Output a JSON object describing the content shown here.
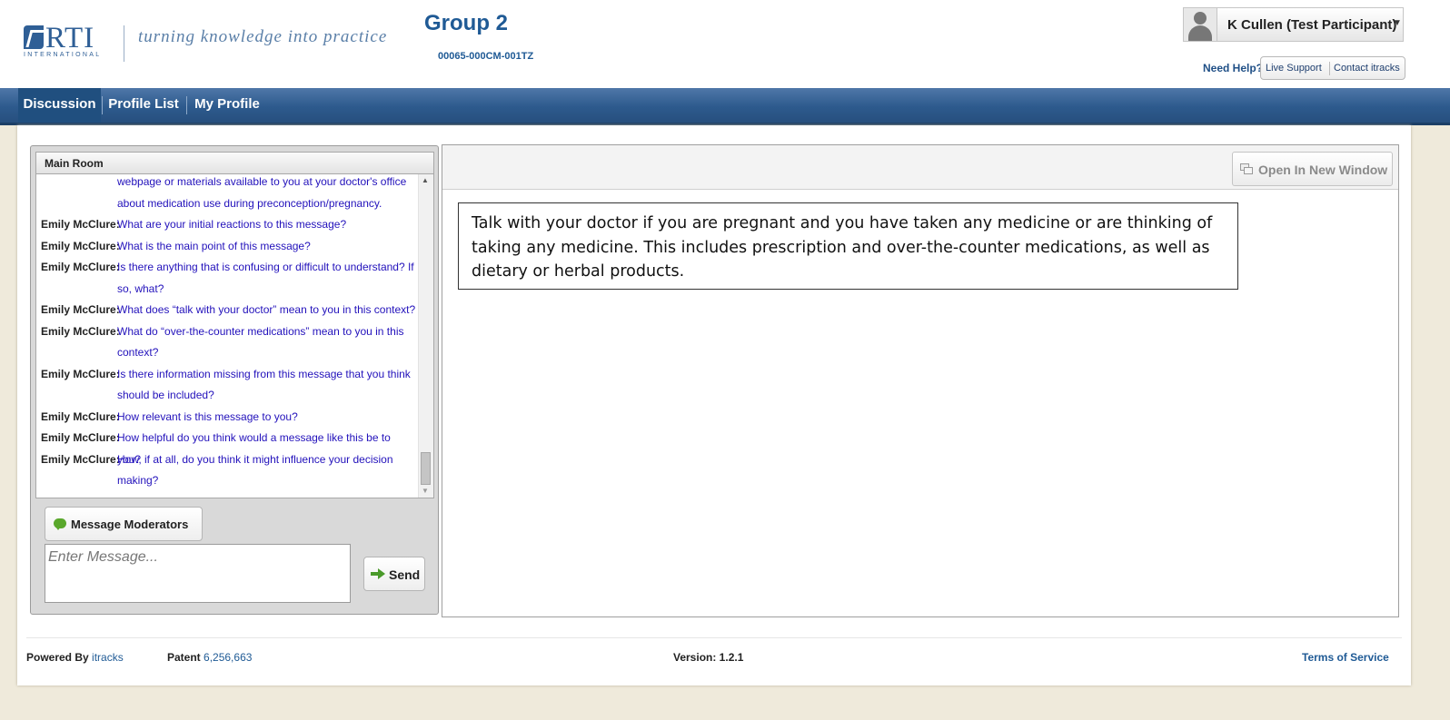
{
  "header": {
    "logo_text": "RTI",
    "logo_subtext": "INTERNATIONAL",
    "tagline": "turning knowledge into practice",
    "group_title": "Group 2",
    "group_code": "00065-000CM-001TZ"
  },
  "user": {
    "name": "K Cullen (Test Participant)"
  },
  "help": {
    "need_help": "Need Help?",
    "live_support": "Live Support",
    "contact": "Contact itracks"
  },
  "nav": {
    "tabs": [
      {
        "label": "Discussion",
        "active": true
      },
      {
        "label": "Profile List",
        "active": false
      },
      {
        "label": "My Profile",
        "active": false
      }
    ]
  },
  "chat": {
    "room_title": "Main Room",
    "messages": [
      {
        "author": "",
        "text": "webpage or materials available to you at your doctor's office about medication use during preconception/pregnancy."
      },
      {
        "author": "Emily McClure:",
        "text": "What are your initial reactions to this message?"
      },
      {
        "author": "Emily McClure:",
        "text": "What is the main point of this message?"
      },
      {
        "author": "Emily McClure:",
        "text": "Is there anything that is confusing or difficult to understand? If so, what?"
      },
      {
        "author": "Emily McClure:",
        "text": "What does “talk with your doctor” mean to you in this context?"
      },
      {
        "author": "Emily McClure:",
        "text": "What do “over-the-counter medications” mean to you in this context?"
      },
      {
        "author": "Emily McClure:",
        "text": "Is there information missing from this message that you think should be included?"
      },
      {
        "author": "Emily McClure:",
        "text": "How relevant is this message to you?"
      },
      {
        "author": "Emily McClure:",
        "text": "How helpful do you think would a message like this be to you?"
      },
      {
        "author": "Emily McClure:",
        "text": "How, if at all, do you think it might influence your decision making?"
      }
    ],
    "message_moderators_label": "Message Moderators",
    "input_placeholder": "Enter Message...",
    "send_label": "Send"
  },
  "stimulus": {
    "open_window_label": "Open In New Window",
    "text": "Talk with your doctor if you are pregnant and you have taken any medicine or are thinking of taking any medicine. This includes prescription and over-the-counter medications, as well as dietary or herbal products."
  },
  "footer": {
    "powered_by_label": "Powered By",
    "powered_by_link": "itracks",
    "patent_label": "Patent",
    "patent_number": "6,256,663",
    "version": "Version: 1.2.1",
    "terms": "Terms of Service"
  },
  "colors": {
    "brand_blue": "#1f5a95",
    "nav_blue": "#2d5a8d",
    "chat_text": "#2211bb",
    "page_bg": "#efeadb"
  }
}
